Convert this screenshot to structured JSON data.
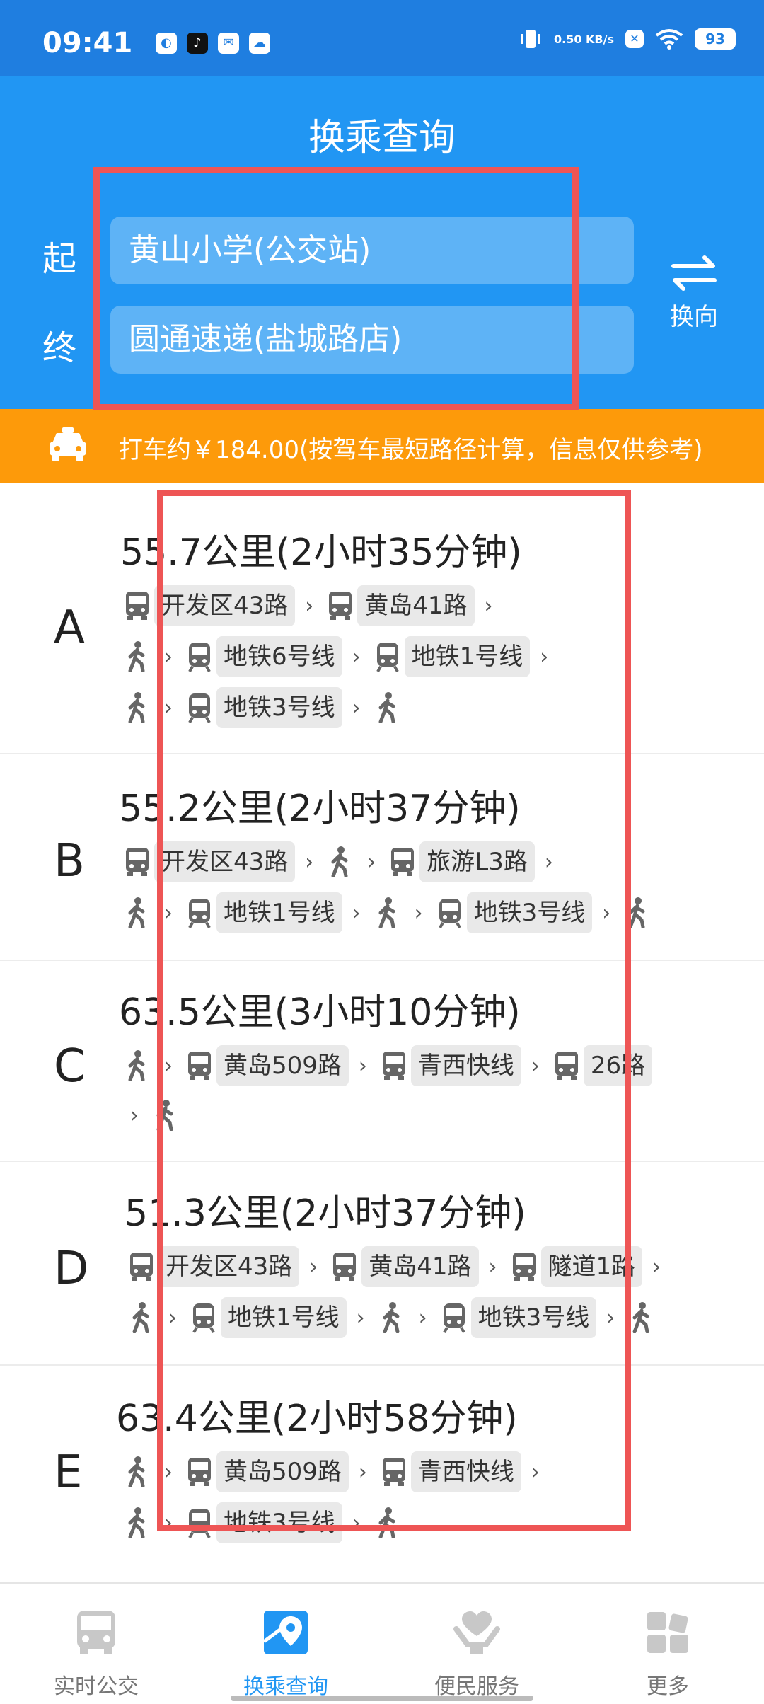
{
  "status_bar": {
    "time": "09:41",
    "net_speed": "0.50 KB/s",
    "battery": "93"
  },
  "header": {
    "title": "换乘查询",
    "start_label": "起",
    "end_label": "终",
    "start_value": "黄山小学(公交站)",
    "end_value": "圆通速递(盐城路店)",
    "swap_label": "换向"
  },
  "taxi": {
    "text": "打车约￥184.00(按驾车最短路径计算，信息仅供参考)"
  },
  "routes": [
    {
      "letter": "A",
      "summary": "55.7公里(2小时35分钟)",
      "lines": [
        "开发区43路",
        "黄岛41路",
        "地铁6号线",
        "地铁1号线",
        "地铁3号线"
      ]
    },
    {
      "letter": "B",
      "summary": "55.2公里(2小时37分钟)",
      "lines": [
        "开发区43路",
        "旅游L3路",
        "地铁1号线",
        "地铁3号线"
      ]
    },
    {
      "letter": "C",
      "summary": "63.5公里(3小时10分钟)",
      "lines": [
        "黄岛509路",
        "青西快线",
        "26路"
      ]
    },
    {
      "letter": "D",
      "summary": "51.3公里(2小时37分钟)",
      "lines": [
        "开发区43路",
        "黄岛41路",
        "隧道1路",
        "地铁1号线",
        "地铁3号线"
      ]
    },
    {
      "letter": "E",
      "summary": "63.4公里(2小时58分钟)",
      "lines": [
        "黄岛509路",
        "青西快线",
        "地铁3号线"
      ]
    }
  ],
  "bottom_nav": [
    {
      "label": "实时公交",
      "icon": "bus-icon"
    },
    {
      "label": "换乘查询",
      "icon": "map-pin-icon"
    },
    {
      "label": "便民服务",
      "icon": "heart-hand-icon"
    },
    {
      "label": "更多",
      "icon": "grid-icon"
    }
  ],
  "colors": {
    "primary": "#2196f3",
    "status_bar": "#1f7ee0",
    "taxi_banner": "#fd9a0a",
    "highlight": "#ee5555",
    "active_nav": "#2196f3"
  }
}
